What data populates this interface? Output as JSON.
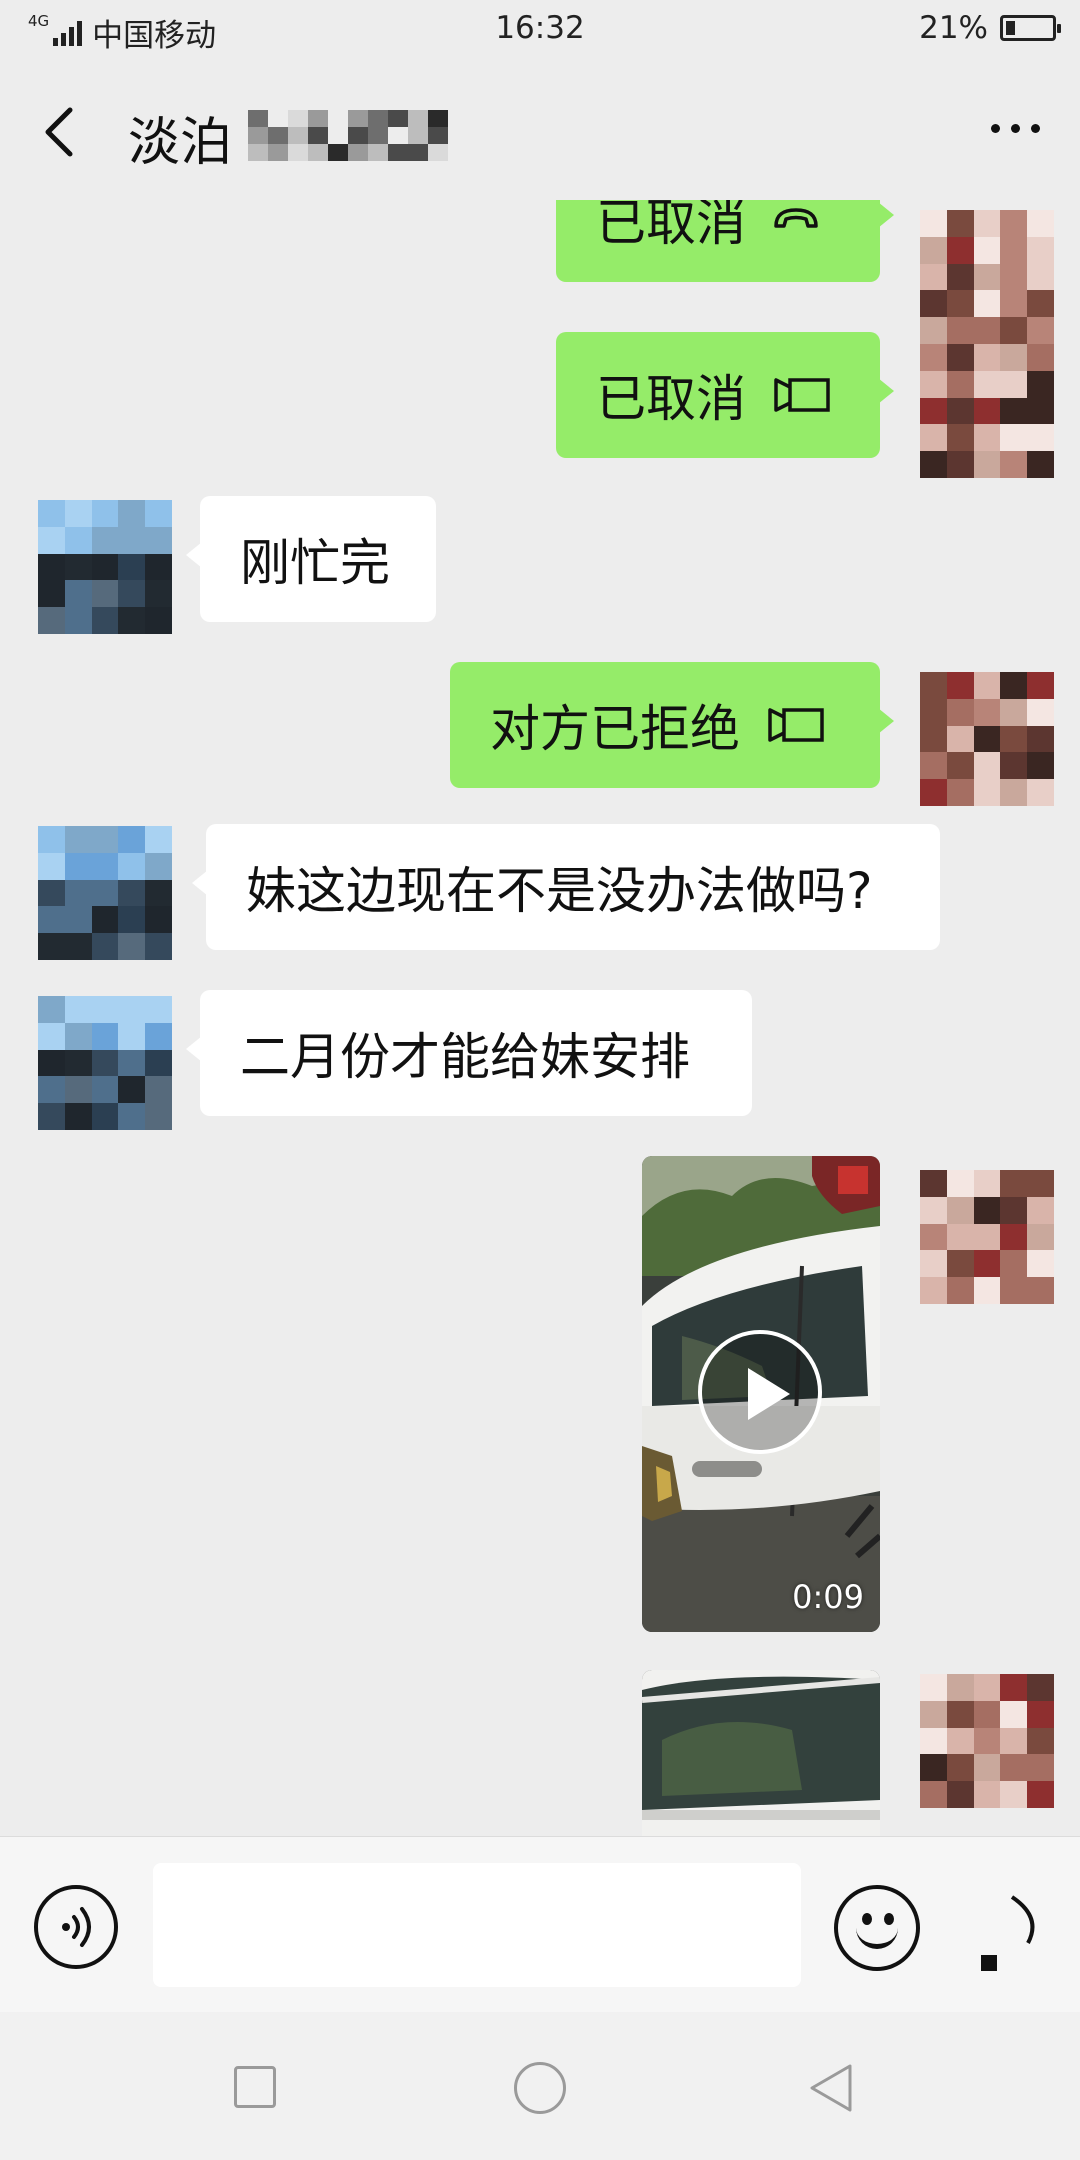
{
  "status_bar": {
    "network": "4G",
    "carrier": "中国移动",
    "time": "16:32",
    "battery_text": "21%",
    "battery_level": 0.21,
    "icons": [
      "signal-icon",
      "battery-icon"
    ]
  },
  "header": {
    "title": "淡泊",
    "back_icon": "chevron-left-icon",
    "more_icon": "more-dots-icon"
  },
  "messages": [
    {
      "from": "me",
      "type": "call",
      "text": "已取消",
      "icon": "phone-hangup-icon"
    },
    {
      "from": "me",
      "type": "call",
      "text": "已取消",
      "icon": "video-call-icon"
    },
    {
      "from": "them",
      "type": "text",
      "text": "刚忙完"
    },
    {
      "from": "me",
      "type": "call",
      "text": "对方已拒绝",
      "icon": "video-call-icon"
    },
    {
      "from": "them",
      "type": "text",
      "text": "妹这边现在不是没办法做吗?"
    },
    {
      "from": "them",
      "type": "text",
      "text": "二月份才能给妹安排"
    },
    {
      "from": "me",
      "type": "video",
      "duration": "0:09",
      "icon": "play-icon"
    },
    {
      "from": "me",
      "type": "video",
      "duration": ""
    }
  ],
  "input_bar": {
    "voice_icon": "voice-mode-icon",
    "placeholder": "",
    "emoji_icon": "emoji-icon",
    "more_icon": "plus-icon"
  },
  "nav_bar": {
    "icons": [
      "recent-apps-icon",
      "home-icon",
      "back-icon"
    ]
  },
  "colors": {
    "background": "#ededed",
    "my_bubble": "#95ec69",
    "their_bubble": "#ffffff"
  }
}
